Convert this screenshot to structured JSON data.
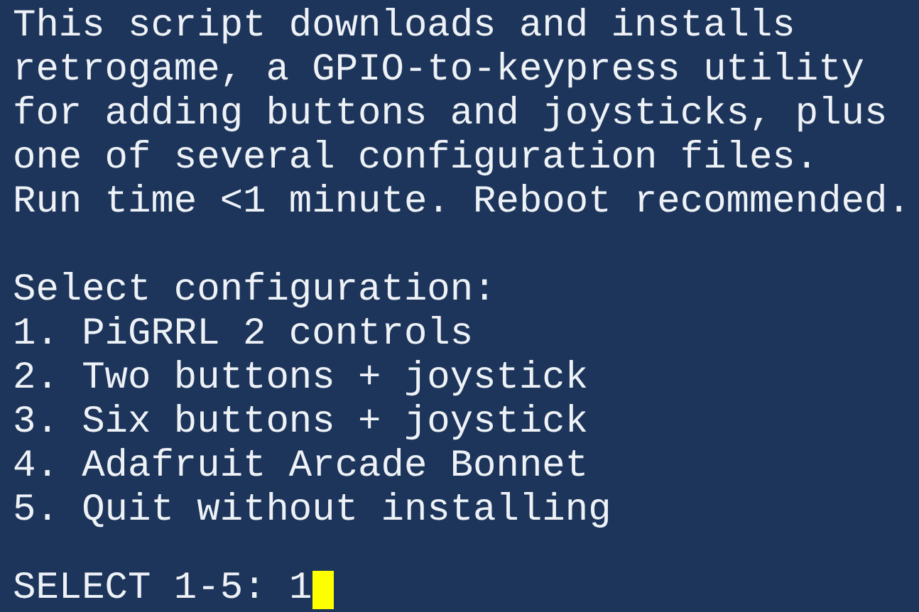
{
  "intro_lines": [
    "This script downloads and installs",
    "retrogame, a GPIO-to-keypress utility",
    "for adding buttons and joysticks, plus",
    "one of several configuration files.",
    "Run time <1 minute. Reboot recommended."
  ],
  "menu": {
    "heading": "Select configuration:",
    "options": [
      "1. PiGRRL 2 controls",
      "2. Two buttons + joystick",
      "3. Six buttons + joystick",
      "4. Adafruit Arcade Bonnet",
      "5. Quit without installing"
    ]
  },
  "prompt": {
    "label": "SELECT 1-5:",
    "value": "1",
    "cursor_visible": true
  }
}
